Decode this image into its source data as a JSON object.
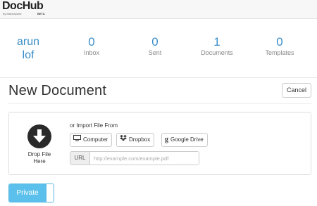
{
  "brand": {
    "name": "DocHub",
    "byline": "by Macrorpoint",
    "badge": "BETA"
  },
  "user": {
    "first": "arun",
    "last": "lof"
  },
  "stats": [
    {
      "value": "0",
      "label": "Inbox"
    },
    {
      "value": "0",
      "label": "Sent"
    },
    {
      "value": "1",
      "label": "Documents"
    },
    {
      "value": "0",
      "label": "Templates"
    }
  ],
  "page": {
    "title": "New Document",
    "cancel_label": "Cancel"
  },
  "upload": {
    "drop_label_line1": "Drop File",
    "drop_label_line2": "Here",
    "import_label": "or Import File From",
    "sources": [
      {
        "label": "Computer",
        "icon": "monitor-icon"
      },
      {
        "label": "Dropbox",
        "icon": "dropbox-icon"
      },
      {
        "label": "Google Drive",
        "icon": "google-drive-icon"
      }
    ],
    "url_addon": "URL",
    "url_placeholder": "http://example.com/example.pdf",
    "url_value": ""
  },
  "privacy": {
    "label": "Private",
    "state": "on"
  },
  "colors": {
    "accent": "#3a8ec9",
    "toggle": "#5bc0eb"
  }
}
